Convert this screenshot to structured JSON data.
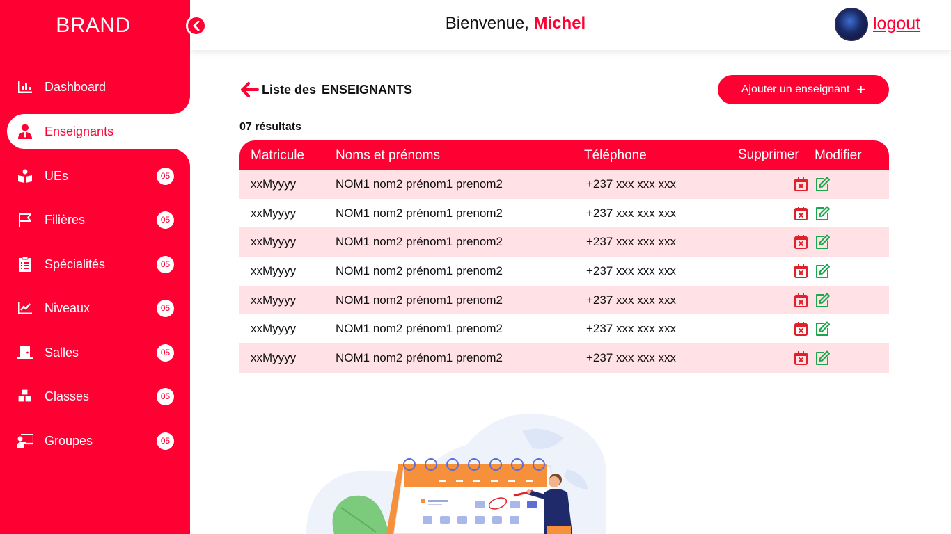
{
  "brand": "BRAND",
  "header": {
    "welcome_prefix": "Bienvenue, ",
    "user_name": "Michel",
    "logout_label": "logout"
  },
  "sidebar": {
    "items": [
      {
        "label": "Dashboard",
        "icon": "chart-bar-icon"
      },
      {
        "label": "Enseignants",
        "icon": "user-tie-icon",
        "active": true
      },
      {
        "label": "UEs",
        "icon": "book-reader-icon",
        "badge": "05"
      },
      {
        "label": "Filières",
        "icon": "flag-icon",
        "badge": "05"
      },
      {
        "label": "Spécialités",
        "icon": "clipboard-list-icon",
        "badge": "05"
      },
      {
        "label": "Niveaux",
        "icon": "chart-line-icon",
        "badge": "05"
      },
      {
        "label": "Salles",
        "icon": "door-icon",
        "badge": "05"
      },
      {
        "label": "Classes",
        "icon": "cubes-icon",
        "badge": "05"
      },
      {
        "label": "Groupes",
        "icon": "chalkboard-teacher-icon",
        "badge": "05"
      }
    ]
  },
  "main": {
    "title_prefix": "Liste des",
    "title_entity": "ENSEIGNANTS",
    "add_button_label": "Ajouter un enseignant",
    "add_button_symbol": "+",
    "results_label": "07 résultats",
    "table": {
      "headers": [
        "Matricule",
        "Noms et prénoms",
        "Téléphone",
        "Supprimer",
        "Modifier"
      ],
      "rows": [
        [
          "xxMyyyy",
          "NOM1 nom2 prénom1 prenom2",
          "+237 xxx xxx xxx"
        ],
        [
          "xxMyyyy",
          "NOM1 nom2 prénom1 prenom2",
          "+237 xxx xxx xxx"
        ],
        [
          "xxMyyyy",
          "NOM1 nom2 prénom1 prenom2",
          "+237 xxx xxx xxx"
        ],
        [
          "xxMyyyy",
          "NOM1 nom2 prénom1 prenom2",
          "+237 xxx xxx xxx"
        ],
        [
          "xxMyyyy",
          "NOM1 nom2 prénom1 prenom2",
          "+237 xxx xxx xxx"
        ],
        [
          "xxMyyyy",
          "NOM1 nom2 prénom1 prenom2",
          "+237 xxx xxx xxx"
        ],
        [
          "xxMyyyy",
          "NOM1 nom2 prénom1 prenom2",
          "+237 xxx xxx xxx"
        ]
      ]
    }
  },
  "colors": {
    "accent": "#ff0033",
    "row_stripe": "#ffe1e6",
    "delete_icon": "#e0202a",
    "edit_icon": "#1aa64a"
  }
}
